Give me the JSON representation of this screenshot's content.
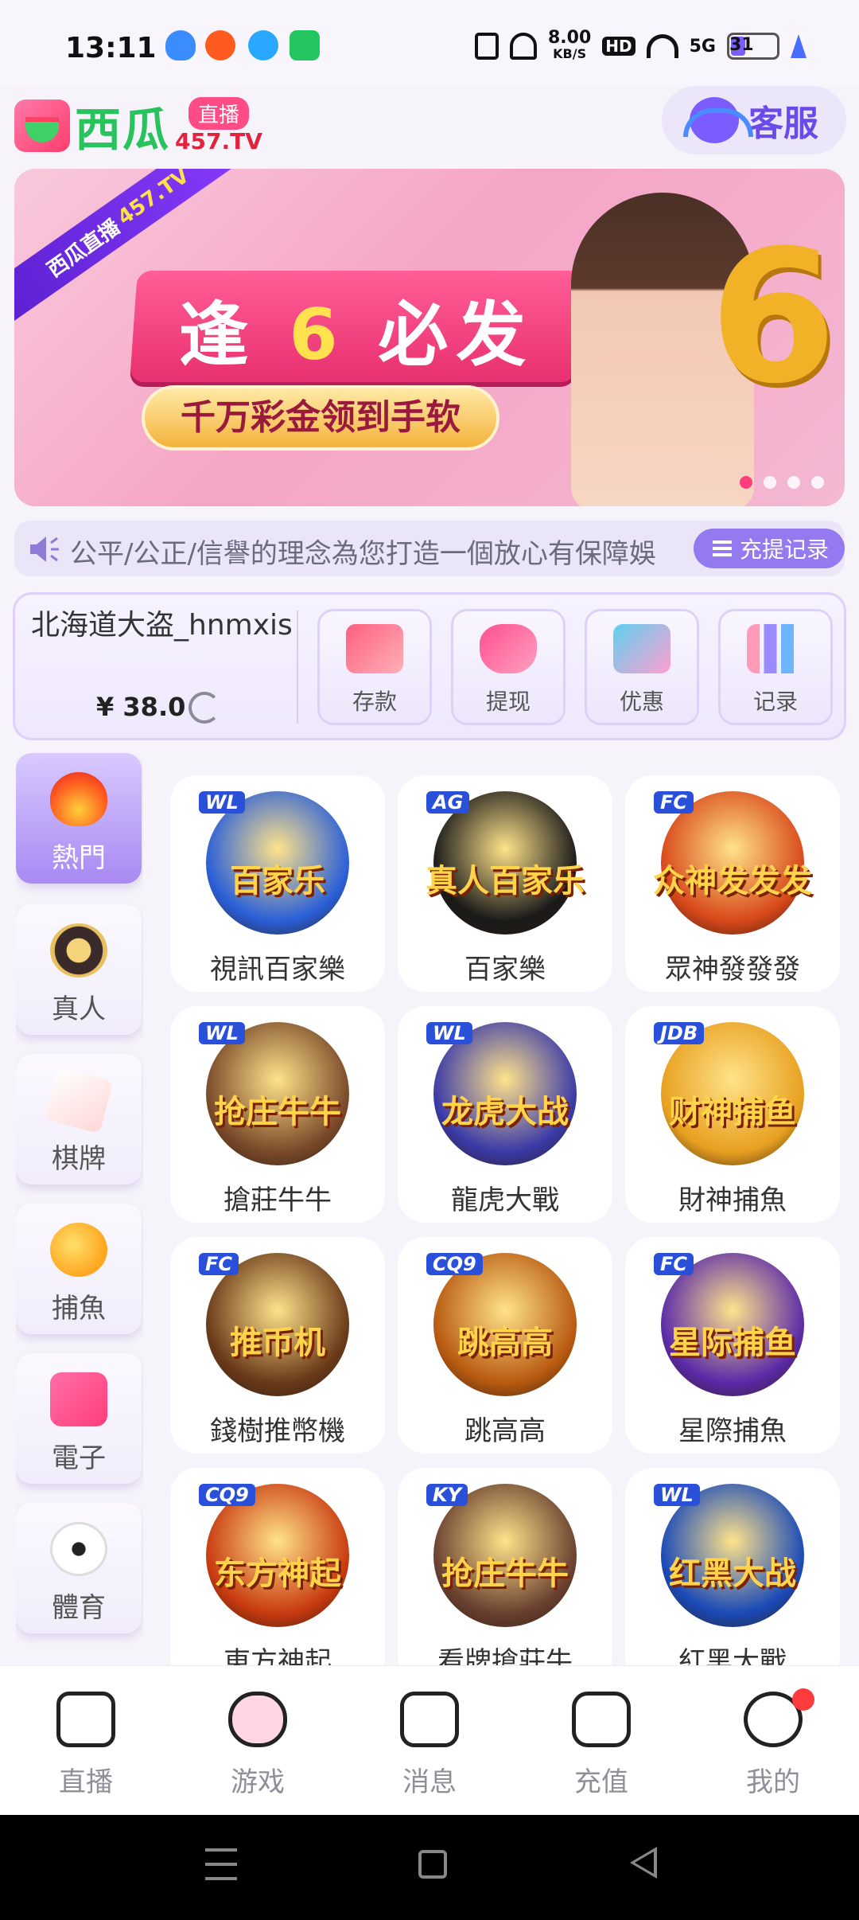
{
  "status_bar": {
    "time": "13:11",
    "net_speed": "8.00",
    "net_unit": "KB/S",
    "hd": "HD",
    "signal": "5G",
    "battery": "31"
  },
  "header": {
    "logo_text": "西瓜",
    "logo_live": "直播",
    "logo_domain": "457.TV",
    "service_label": "客服"
  },
  "banner": {
    "ribbon_text": "西瓜直播",
    "ribbon_domain": "457.TV",
    "title_pre": "逢",
    "title_num": "6",
    "title_post": "必发",
    "subtitle": "千万彩金领到手软",
    "big_number": "6",
    "dots": 4,
    "active_dot": 0
  },
  "marquee": {
    "text": "公平/公正/信譽的理念為您打造一個放心有保障娛",
    "record_button": "充提记录"
  },
  "account": {
    "username": "北海道大盗_hnmxis",
    "balance": "¥ 38.0",
    "actions": [
      {
        "label": "存款",
        "icon": "card-icon",
        "color": "#ff7a8a"
      },
      {
        "label": "提现",
        "icon": "money-bag-icon",
        "color": "#ff6fa0"
      },
      {
        "label": "优惠",
        "icon": "gift-icon",
        "color": "#6fd3f0"
      },
      {
        "label": "记录",
        "icon": "bar-chart-icon",
        "color": "#7fb4ff"
      }
    ]
  },
  "categories": [
    {
      "label": "熱門",
      "icon": "flame-icon",
      "active": true
    },
    {
      "label": "真人",
      "icon": "poker-chip-icon",
      "active": false
    },
    {
      "label": "棋牌",
      "icon": "playing-card-icon",
      "active": false
    },
    {
      "label": "捕魚",
      "icon": "fish-icon",
      "active": false
    },
    {
      "label": "電子",
      "icon": "slot-machine-icon",
      "active": false
    },
    {
      "label": "體育",
      "icon": "soccer-ball-icon",
      "active": false
    }
  ],
  "games": [
    {
      "name": "視訊百家樂",
      "brand": "WL",
      "art_text": "百家乐",
      "color": "#2a5fd8"
    },
    {
      "name": "百家樂",
      "brand": "AG",
      "art_text": "真人百家乐",
      "color": "#1a1a1a"
    },
    {
      "name": "眾神發發發",
      "brand": "FC",
      "art_text": "众神发发发",
      "color": "#d8481a"
    },
    {
      "name": "搶莊牛牛",
      "brand": "WL",
      "art_text": "抢庄牛牛",
      "color": "#7a4a2a"
    },
    {
      "name": "龍虎大戰",
      "brand": "WL",
      "art_text": "龙虎大战",
      "color": "#3a3aa8"
    },
    {
      "name": "財神捕魚",
      "brand": "JDB",
      "art_text": "财神捕鱼",
      "color": "#e8a020"
    },
    {
      "name": "錢樹推幣機",
      "brand": "FC",
      "art_text": "推币机",
      "color": "#6a3a1a"
    },
    {
      "name": "跳高高",
      "brand": "CQ9",
      "art_text": "跳高高",
      "color": "#b85a10"
    },
    {
      "name": "星際捕魚",
      "brand": "FC",
      "art_text": "星际捕鱼",
      "color": "#5a2aa8"
    },
    {
      "name": "東方神起",
      "brand": "CQ9",
      "art_text": "东方神起",
      "color": "#c83a10"
    },
    {
      "name": "看牌搶莊牛",
      "brand": "KY",
      "art_text": "抢庄牛牛",
      "color": "#6a4030"
    },
    {
      "name": "紅黑大戰",
      "brand": "WL",
      "art_text": "红黑大战",
      "color": "#1a4ab8"
    }
  ],
  "nav": [
    {
      "label": "直播",
      "icon": "camera-icon"
    },
    {
      "label": "游戏",
      "icon": "gamepad-icon"
    },
    {
      "label": "消息",
      "icon": "chat-icon"
    },
    {
      "label": "充值",
      "icon": "wallet-icon"
    },
    {
      "label": "我的",
      "icon": "profile-icon"
    }
  ]
}
